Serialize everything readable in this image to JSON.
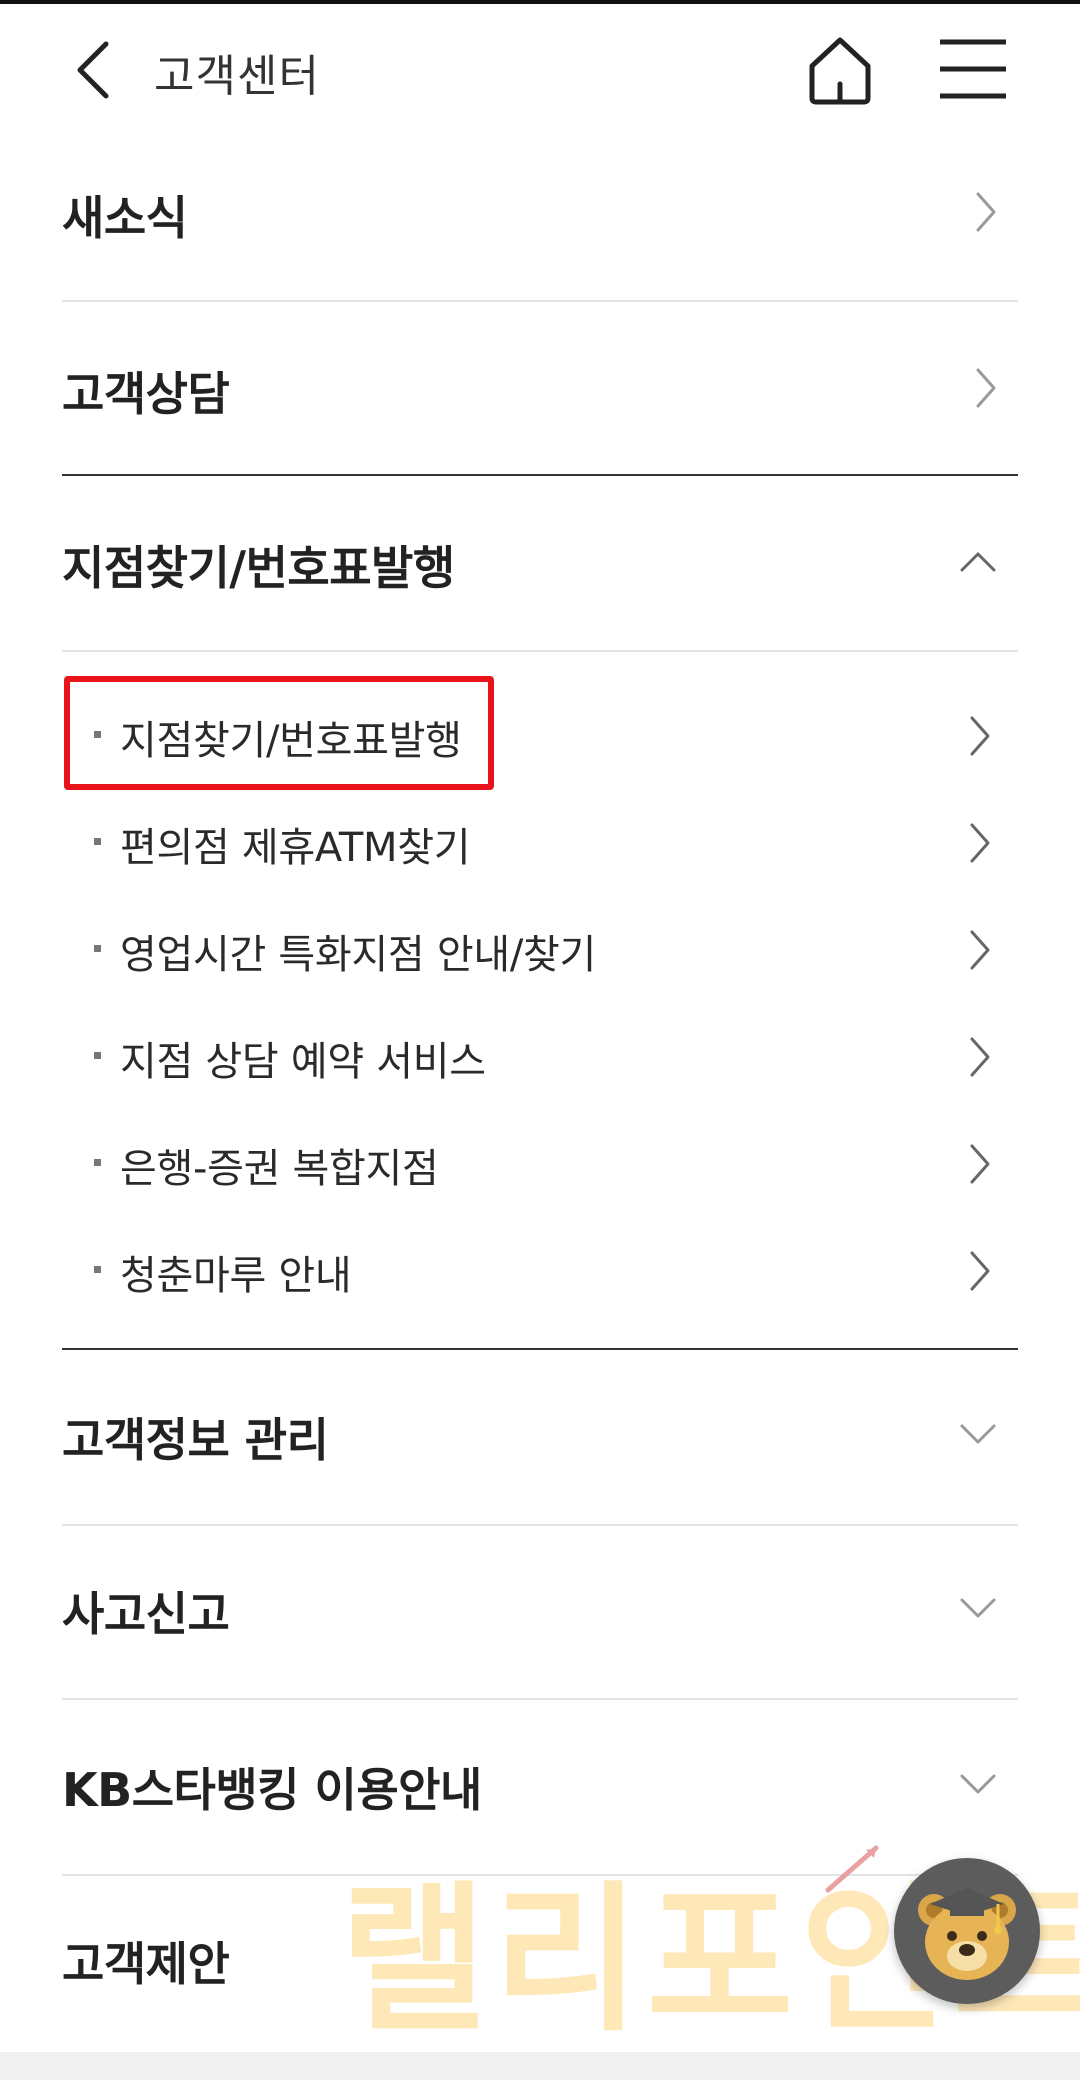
{
  "header": {
    "title": "고객센터",
    "back_icon": "chevron-left-icon",
    "home_icon": "home-icon",
    "menu_icon": "hamburger-menu-icon"
  },
  "sections": [
    {
      "label": "새소식",
      "icon": "chevron-right-icon"
    },
    {
      "label": "고객상담",
      "icon": "chevron-right-icon"
    },
    {
      "label": "지점찾기/번호표발행",
      "icon": "chevron-up-icon",
      "expanded": true
    },
    {
      "label": "고객정보 관리",
      "icon": "chevron-down-icon"
    },
    {
      "label": "사고신고",
      "icon": "chevron-down-icon"
    },
    {
      "label": "KB스타뱅킹 이용안내",
      "icon": "chevron-down-icon"
    },
    {
      "label": "고객제안",
      "icon": "chevron-down-icon"
    }
  ],
  "sub_items": [
    {
      "label": "지점찾기/번호표발행",
      "highlighted": true
    },
    {
      "label": "편의점 제휴ATM찾기"
    },
    {
      "label": "영업시간 특화지점 안내/찾기"
    },
    {
      "label": "지점 상담 예약 서비스"
    },
    {
      "label": "은행-증권 복합지점"
    },
    {
      "label": "청춘마루 안내"
    }
  ],
  "watermark": {
    "text": "랠리포인트"
  },
  "chatbot": {
    "icon": "bear-mascot-icon"
  },
  "colors": {
    "highlight": "#e8131b",
    "divider_light": "#e4e4e4",
    "divider_dark": "#333333",
    "watermark": "#ffd98a"
  }
}
